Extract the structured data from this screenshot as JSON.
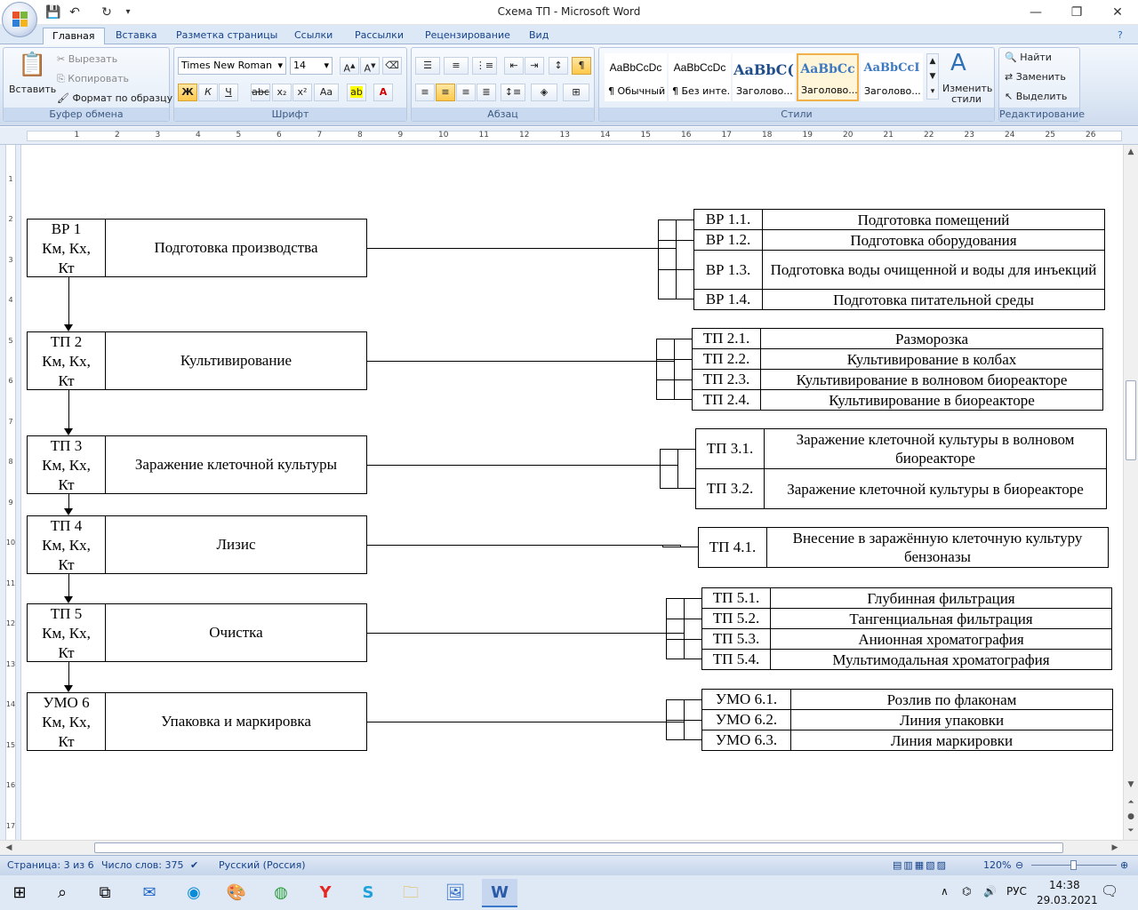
{
  "window": {
    "title": "Схема ТП - Microsoft Word"
  },
  "ribbon": {
    "tabs": [
      "Главная",
      "Вставка",
      "Разметка страницы",
      "Ссылки",
      "Рассылки",
      "Рецензирование",
      "Вид"
    ],
    "clipboard": {
      "paste": "Вставить",
      "cut": "Вырезать",
      "copy": "Копировать",
      "format_painter": "Формат по образцу",
      "label": "Буфер обмена"
    },
    "font": {
      "name": "Times New Roman",
      "size": "14",
      "label": "Шрифт"
    },
    "paragraph": {
      "label": "Абзац"
    },
    "styles": {
      "tiles": [
        {
          "preview": "AaBbCcDc",
          "name": "¶ Обычный"
        },
        {
          "preview": "AaBbCcDc",
          "name": "¶ Без инте..."
        },
        {
          "preview": "AaBbC(",
          "name": "Заголово..."
        },
        {
          "preview": "AaBbCc",
          "name": "Заголово..."
        },
        {
          "preview": "AaBbCcI",
          "name": "Заголово..."
        }
      ],
      "change": "Изменить стили",
      "label": "Стили"
    },
    "editing": {
      "find": "Найти",
      "replace": "Заменить",
      "select": "Выделить",
      "label": "Редактирование"
    }
  },
  "diagram": {
    "stages": [
      {
        "code": [
          "ВР 1",
          "Км, Кх,",
          "Кт"
        ],
        "name": "Подготовка производства",
        "subs": [
          {
            "code": "ВР 1.1.",
            "text": "Подготовка помещений"
          },
          {
            "code": "ВР 1.2.",
            "text": "Подготовка оборудования"
          },
          {
            "code": "ВР 1.3.",
            "text": "Подготовка воды очищенной и воды для инъекций"
          },
          {
            "code": "ВР 1.4.",
            "text": "Подготовка питательной среды"
          }
        ]
      },
      {
        "code": [
          "ТП 2",
          "Км, Кх,",
          "Кт"
        ],
        "name": "Культивирование",
        "subs": [
          {
            "code": "ТП 2.1.",
            "text": "Разморозка"
          },
          {
            "code": "ТП 2.2.",
            "text": "Культивирование в колбах"
          },
          {
            "code": "ТП 2.3.",
            "text": "Культивирование в волновом биореакторе"
          },
          {
            "code": "ТП 2.4.",
            "text": "Культивирование в биореакторе"
          }
        ]
      },
      {
        "code": [
          "ТП 3",
          "Км, Кх,",
          "Кт"
        ],
        "name": "Заражение клеточной культуры",
        "subs": [
          {
            "code": "ТП 3.1.",
            "text": "Заражение клеточной культуры в волновом биореакторе"
          },
          {
            "code": "ТП 3.2.",
            "text": "Заражение клеточной культуры в биореакторе"
          }
        ]
      },
      {
        "code": [
          "ТП 4",
          "Км, Кх,",
          "Кт"
        ],
        "name": "Лизис",
        "subs": [
          {
            "code": "ТП 4.1.",
            "text": "Внесение в заражённую клеточную культуру бензоназы"
          }
        ]
      },
      {
        "code": [
          "ТП 5",
          "Км, Кх,",
          "Кт"
        ],
        "name": "Очистка",
        "subs": [
          {
            "code": "ТП 5.1.",
            "text": "Глубинная фильтрация"
          },
          {
            "code": "ТП 5.2.",
            "text": "Тангенциальная фильтрация"
          },
          {
            "code": "ТП 5.3.",
            "text": "Анионная хроматография"
          },
          {
            "code": "ТП 5.4.",
            "text": "Мультимодальная хроматография"
          }
        ]
      },
      {
        "code": [
          "УМО 6",
          "Км, Кх,",
          "Кт"
        ],
        "name": "Упаковка и маркировка",
        "subs": [
          {
            "code": "УМО 6.1.",
            "text": "Розлив по флаконам"
          },
          {
            "code": "УМО 6.2.",
            "text": "Линия упаковки"
          },
          {
            "code": "УМО 6.3.",
            "text": "Линия маркировки"
          }
        ]
      }
    ]
  },
  "status": {
    "page": "Страница: 3 из 6",
    "words": "Число слов: 375",
    "language": "Русский (Россия)",
    "zoom": "120%"
  },
  "taskbar": {
    "lang": "РУС",
    "time": "14:38",
    "date": "29.03.2021"
  },
  "colors": {
    "ribbon_blue": "#dde8f6",
    "accent": "#15428b",
    "selected_style": "#f1b04a"
  }
}
